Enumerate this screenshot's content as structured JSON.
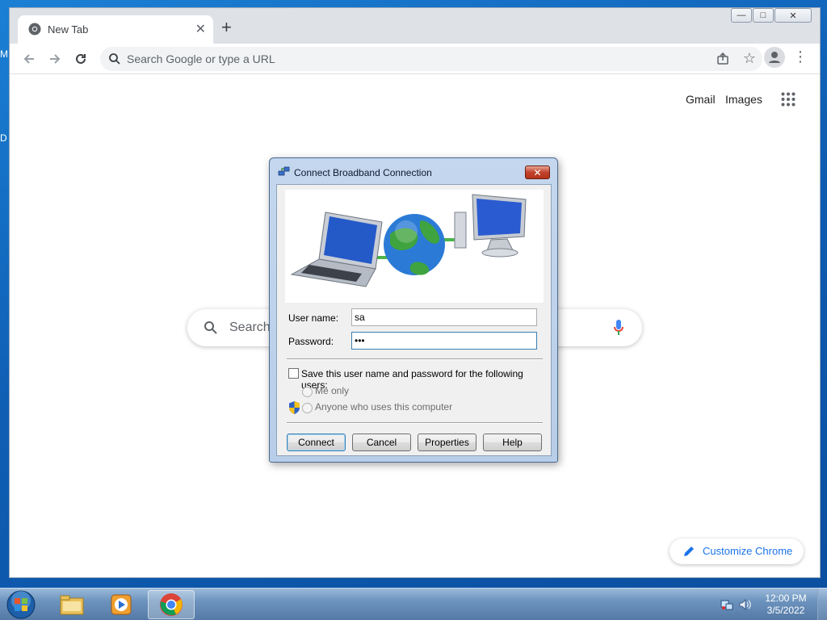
{
  "desktop": {
    "icon_labels": [
      "M",
      "D"
    ]
  },
  "browser": {
    "tab": {
      "title": "New Tab",
      "close": "✕"
    },
    "new_tab": "+",
    "window_controls": {
      "minimize": "—",
      "maximize": "□",
      "close": "✕"
    },
    "omnibox": {
      "placeholder": "Search Google or type a URL"
    },
    "header_links": {
      "gmail": "Gmail",
      "images": "Images"
    },
    "search_box": {
      "placeholder": "Search"
    },
    "customize": {
      "label": "Customize Chrome"
    }
  },
  "dialog": {
    "title": "Connect Broadband Connection",
    "close": "✕",
    "username_label": "User name:",
    "username_value": "sa",
    "password_label": "Password:",
    "password_value": "•••",
    "save_checkbox_label": "Save this user name and password for the following users:",
    "radio_me_only": "Me only",
    "radio_anyone": "Anyone who uses this computer",
    "buttons": {
      "connect": "Connect",
      "cancel": "Cancel",
      "properties": "Properties",
      "help": "Help"
    }
  },
  "taskbar": {
    "time": "12:00 PM",
    "date": "3/5/2022"
  },
  "colors": {
    "chrome_accent": "#1a73e8",
    "desktop_blue": "#1b80d4",
    "dialog_frame": "#c4d7ee"
  }
}
